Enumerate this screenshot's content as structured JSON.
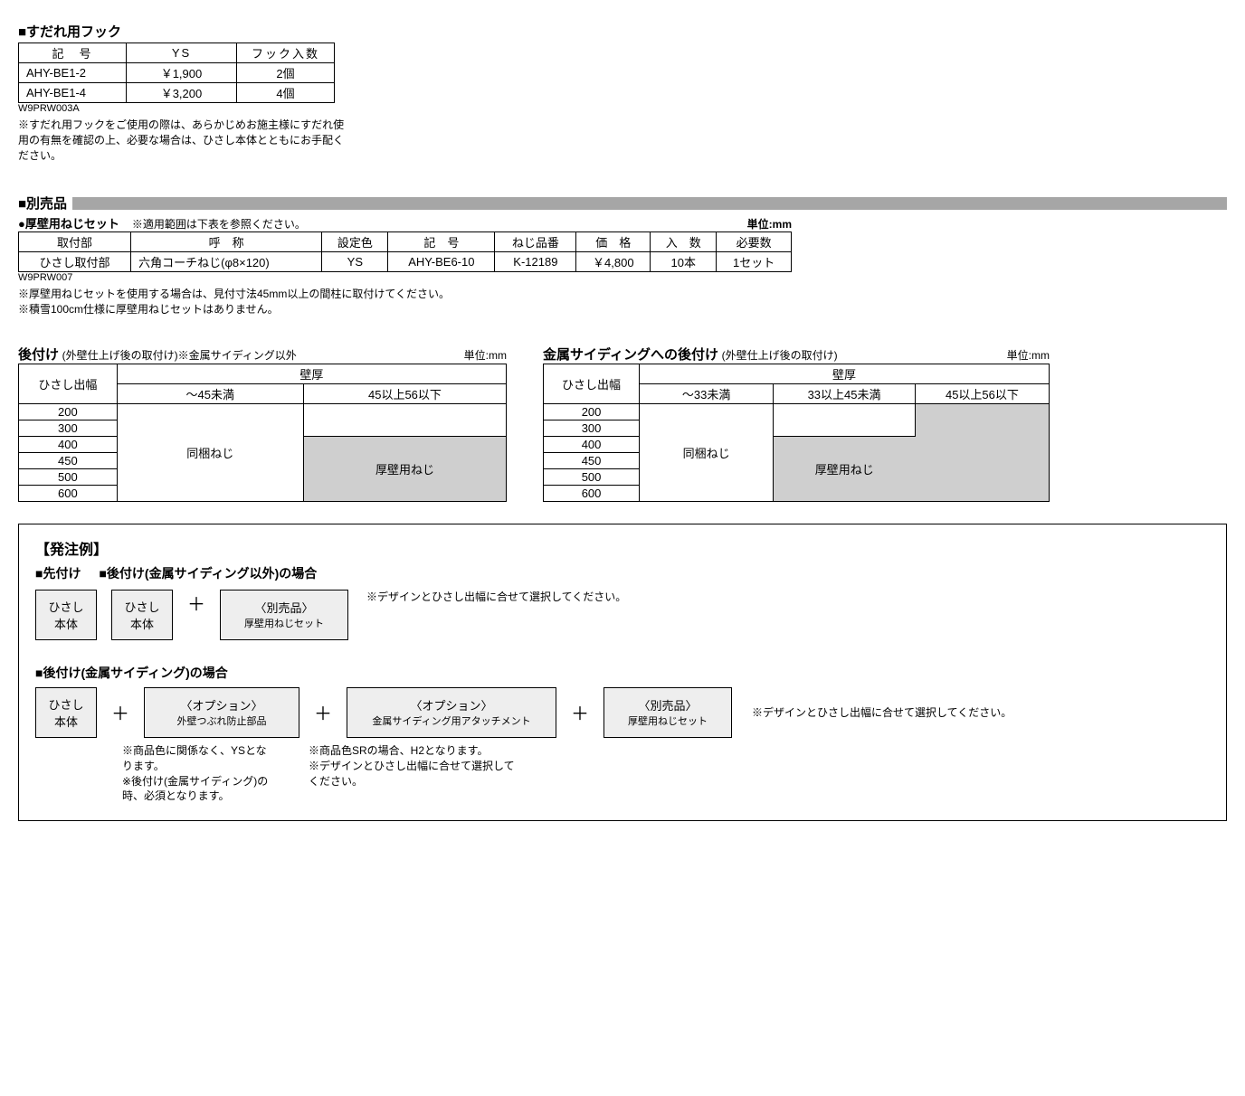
{
  "hook": {
    "title": "■すだれ用フック",
    "headers": [
      "記　号",
      "YS",
      "フック入数"
    ],
    "rows": [
      {
        "code": "AHY-BE1-2",
        "price": "￥1,900",
        "qty": "2個"
      },
      {
        "code": "AHY-BE1-4",
        "price": "￥3,200",
        "qty": "4個"
      }
    ],
    "ref": "W9PRW003A",
    "note": "※すだれ用フックをご使用の際は、あらかじめお施主様にすだれ使用の有無を確認の上、必要な場合は、ひさし本体とともにお手配ください。"
  },
  "separate": {
    "title": "■別売品",
    "sub_title": "●厚壁用ねじセット",
    "sub_note": "※適用範囲は下表を参照ください。",
    "unit": "単位:mm",
    "headers": [
      "取付部",
      "呼　称",
      "設定色",
      "記　号",
      "ねじ品番",
      "価　格",
      "入　数",
      "必要数"
    ],
    "row": {
      "part": "ひさし取付部",
      "name": "六角コーチねじ(φ8×120)",
      "color": "YS",
      "code": "AHY-BE6-10",
      "screw": "K-12189",
      "price": "￥4,800",
      "qty": "10本",
      "need": "1セット"
    },
    "ref": "W9PRW007",
    "note1": "※厚壁用ねじセットを使用する場合は、見付寸法45mm以上の間柱に取付けてください。",
    "note2": "※積雪100cm仕様に厚壁用ねじセットはありません。"
  },
  "tbl_left": {
    "title": "後付け",
    "title_sub": "(外壁仕上げ後の取付け)※金属サイディング以外",
    "unit": "単位:mm",
    "rowhead": "ひさし出幅",
    "colgroup": "壁厚",
    "cols": [
      "～45未満",
      "45以上56以下"
    ],
    "rows": [
      "200",
      "300",
      "400",
      "450",
      "500",
      "600"
    ],
    "cell_a": "同梱ねじ",
    "cell_b": "厚壁用ねじ"
  },
  "tbl_right": {
    "title": "金属サイディングへの後付け",
    "title_sub": "(外壁仕上げ後の取付け)",
    "unit": "単位:mm",
    "rowhead": "ひさし出幅",
    "colgroup": "壁厚",
    "cols": [
      "～33未満",
      "33以上45未満",
      "45以上56以下"
    ],
    "rows": [
      "200",
      "300",
      "400",
      "450",
      "500",
      "600"
    ],
    "cell_a": "同梱ねじ",
    "cell_b": "厚壁用ねじ"
  },
  "order": {
    "heading": "【発注例】",
    "line1_a": "■先付け",
    "line1_b": "■後付け(金属サイディング以外)の場合",
    "line1_note": "※デザインとひさし出幅に合せて選択してください。",
    "chip_body": "ひさし\n本体",
    "chip_opt_label": "〈別売品〉",
    "chip_opt_sub": "厚壁用ねじセット",
    "line2_title": "■後付け(金属サイディング)の場合",
    "chip_opt2_label": "〈オプション〉",
    "chip_opt2_sub": "外壁つぶれ防止部品",
    "chip_opt3_label": "〈オプション〉",
    "chip_opt3_sub": "金属サイディング用アタッチメント",
    "chip_opt4_label": "〈別売品〉",
    "chip_opt4_sub": "厚壁用ねじセット",
    "line2_note_right": "※デザインとひさし出幅に合せて選択してください。",
    "foot_a": "※商品色に関係なく、YSとなります。\n※後付け(金属サイディング)の時、必須となります。",
    "foot_b": "※商品色SRの場合、H2となります。\n※デザインとひさし出幅に合せて選択してください。"
  }
}
